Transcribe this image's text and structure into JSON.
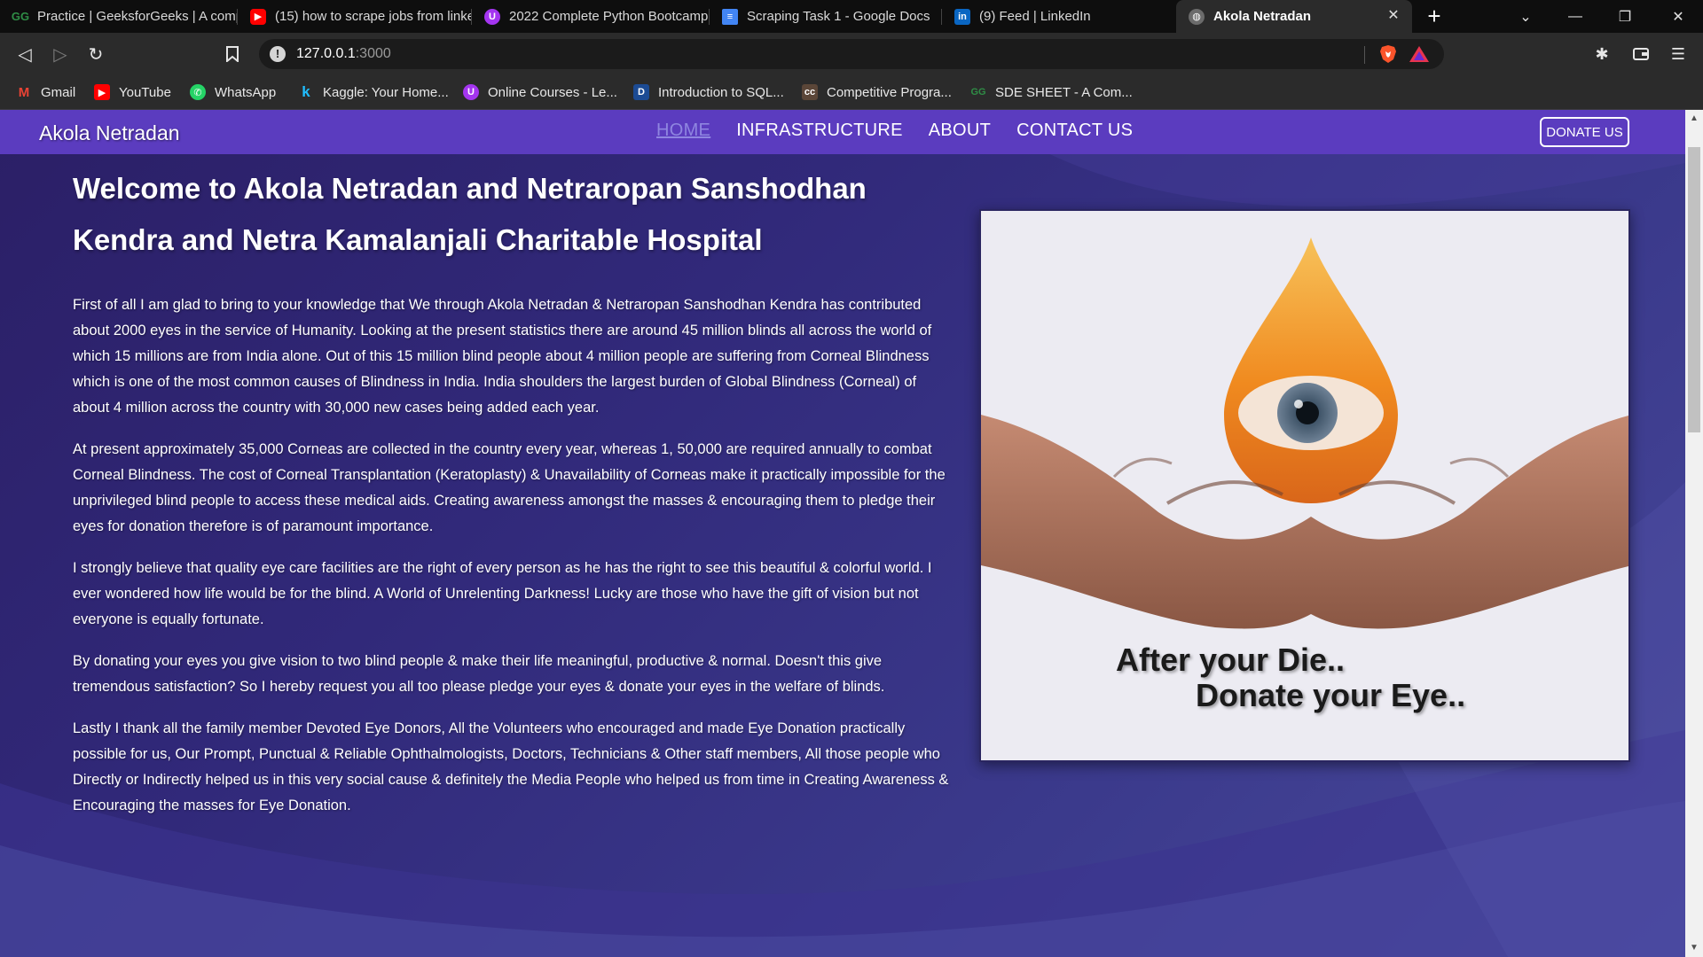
{
  "browser": {
    "tabs": [
      {
        "title": "Practice | GeeksforGeeks | A comp",
        "icon": "geeksforgeeks-icon"
      },
      {
        "title": "(15) how to scrape jobs from linke",
        "icon": "youtube-icon"
      },
      {
        "title": "2022 Complete Python Bootcamp",
        "icon": "udemy-icon"
      },
      {
        "title": "Scraping Task 1 - Google Docs",
        "icon": "google-docs-icon"
      },
      {
        "title": "(9) Feed | LinkedIn",
        "icon": "linkedin-icon"
      },
      {
        "title": "Akola Netradan",
        "icon": "globe-icon"
      }
    ],
    "url_host": "127.0.0.1",
    "url_port": ":3000",
    "bookmarks": [
      {
        "label": "Gmail",
        "icon": "gmail-icon"
      },
      {
        "label": "YouTube",
        "icon": "youtube-icon"
      },
      {
        "label": "WhatsApp",
        "icon": "whatsapp-icon"
      },
      {
        "label": "Kaggle: Your Home...",
        "icon": "kaggle-icon"
      },
      {
        "label": "Online Courses - Le...",
        "icon": "udemy-icon"
      },
      {
        "label": "Introduction to SQL...",
        "icon": "datacamp-icon"
      },
      {
        "label": "Competitive Progra...",
        "icon": "codechef-icon"
      },
      {
        "label": "SDE SHEET - A Com...",
        "icon": "geeksforgeeks-icon"
      }
    ]
  },
  "site": {
    "brand": "Akola Netradan",
    "nav": [
      "HOME",
      "INFRASTRUCTURE",
      "ABOUT",
      "CONTACT US"
    ],
    "donate_label": "DONATE US",
    "heading": "Welcome to Akola Netradan and Netraropan Sanshodhan Kendra and Netra Kamalanjali Charitable Hospital",
    "paragraphs": [
      "First of all I am glad to bring to your knowledge that We through Akola Netradan & Netraropan Sanshodhan Kendra has contributed about 2000 eyes in the service of Humanity. Looking at the present statistics there are around 45 million blinds all across the world of which 15 millions are from India alone. Out of this 15 million blind people about 4 million people are suffering from Corneal Blindness which is one of the most common causes of Blindness in India. India shoulders the largest burden of Global Blindness (Corneal) of about 4 million across the country with 30,000 new cases being added each year.",
      "At present approximately 35,000 Corneas are collected in the country every year, whereas 1, 50,000 are required annually to combat Corneal Blindness. The cost of Corneal Transplantation (Keratoplasty) & Unavailability of Corneas make it practically impossible for the unprivileged blind people to access these medical aids. Creating awareness amongst the masses & encouraging them to pledge their eyes for donation therefore is of paramount importance.",
      "I strongly believe that quality eye care facilities are the right of every person as he has the right to see this beautiful & colorful world. I ever wondered how life would be for the blind. A World of Unrelenting Darkness! Lucky are those who have the gift of vision but not everyone is equally fortunate.",
      "By donating your eyes you give vision to two blind people & make their life meaningful, productive & normal. Doesn't this give tremendous satisfaction? So I hereby request you all too please pledge your eyes & donate your eyes in the welfare of blinds.",
      "Lastly I thank all the family member Devoted Eye Donors, All the Volunteers who encouraged and made Eye Donation practically possible for us, Our Prompt, Punctual & Reliable Ophthalmologists, Doctors, Technicians & Other staff members, All those people who Directly or Indirectly helped us in this very social cause & definitely the Media People who helped us from time in Creating Awareness & Encouraging the masses for Eye Donation."
    ],
    "hero_caption_line1": "After your Die..",
    "hero_caption_line2": "Donate your Eye.."
  },
  "colors": {
    "navbar": "#5b3cbf",
    "page_bg": "#31297a",
    "active_nav": "#8f86e0"
  }
}
